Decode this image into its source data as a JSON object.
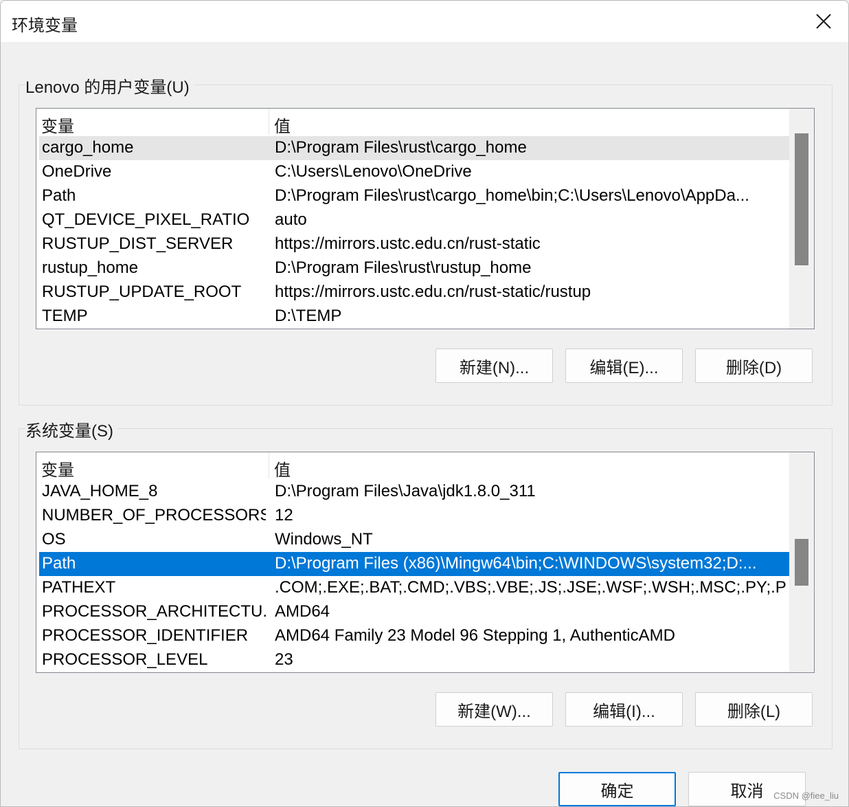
{
  "window": {
    "title": "环境变量",
    "close_icon": "close-icon"
  },
  "user_vars": {
    "group_label": "Lenovo 的用户变量(U)",
    "col_name": "变量",
    "col_value": "值",
    "rows": [
      {
        "name": "cargo_home",
        "value": "D:\\Program Files\\rust\\cargo_home"
      },
      {
        "name": "OneDrive",
        "value": "C:\\Users\\Lenovo\\OneDrive"
      },
      {
        "name": "Path",
        "value": "D:\\Program Files\\rust\\cargo_home\\bin;C:\\Users\\Lenovo\\AppDa..."
      },
      {
        "name": "QT_DEVICE_PIXEL_RATIO",
        "value": "auto"
      },
      {
        "name": "RUSTUP_DIST_SERVER",
        "value": "https://mirrors.ustc.edu.cn/rust-static"
      },
      {
        "name": "rustup_home",
        "value": "D:\\Program Files\\rust\\rustup_home"
      },
      {
        "name": "RUSTUP_UPDATE_ROOT",
        "value": "https://mirrors.ustc.edu.cn/rust-static/rustup"
      },
      {
        "name": "TEMP",
        "value": "D:\\TEMP"
      }
    ],
    "new_label": "新建(N)...",
    "edit_label": "编辑(E)...",
    "delete_label": "删除(D)"
  },
  "system_vars": {
    "group_label": "系统变量(S)",
    "col_name": "变量",
    "col_value": "值",
    "rows": [
      {
        "name": "JAVA_HOME_8",
        "value": "D:\\Program Files\\Java\\jdk1.8.0_311"
      },
      {
        "name": "NUMBER_OF_PROCESSORS",
        "value": "12"
      },
      {
        "name": "OS",
        "value": "Windows_NT"
      },
      {
        "name": "Path",
        "value": "D:\\Program Files (x86)\\Mingw64\\bin;C:\\WINDOWS\\system32;D:..."
      },
      {
        "name": "PATHEXT",
        "value": ".COM;.EXE;.BAT;.CMD;.VBS;.VBE;.JS;.JSE;.WSF;.WSH;.MSC;.PY;.PY..."
      },
      {
        "name": "PROCESSOR_ARCHITECTU...",
        "value": "AMD64"
      },
      {
        "name": "PROCESSOR_IDENTIFIER",
        "value": "AMD64 Family 23 Model 96 Stepping 1, AuthenticAMD"
      },
      {
        "name": "PROCESSOR_LEVEL",
        "value": "23"
      }
    ],
    "new_label": "新建(W)...",
    "edit_label": "编辑(I)...",
    "delete_label": "删除(L)"
  },
  "footer": {
    "ok_label": "确定",
    "cancel_label": "取消"
  },
  "watermark": "CSDN @fiee_liu",
  "colors": {
    "selection": "#0078d7",
    "hover": "#e5e5e5",
    "scroll_thumb": "#868686"
  }
}
